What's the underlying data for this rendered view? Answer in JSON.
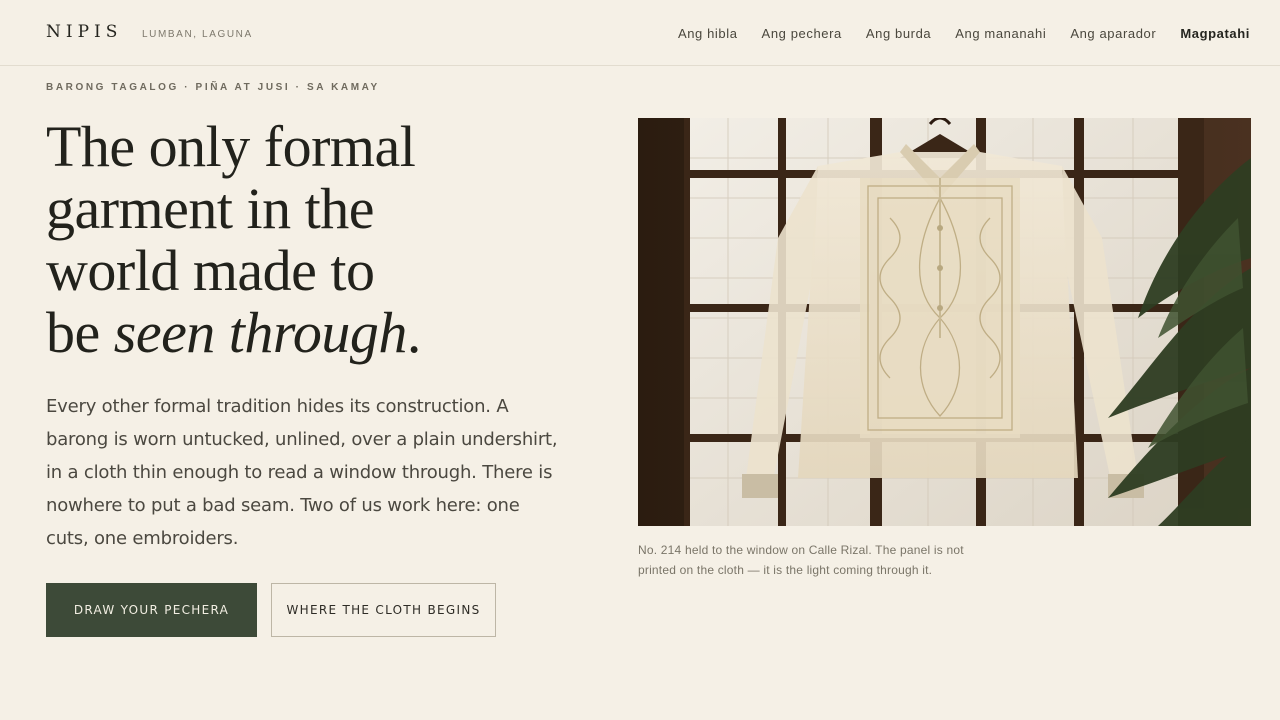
{
  "brand": {
    "name": "NIPIS",
    "location": "LUMBAN, LAGUNA"
  },
  "nav": {
    "items": [
      "Ang hibla",
      "Ang pechera",
      "Ang burda",
      "Ang mananahi",
      "Ang aparador"
    ],
    "cta": "Magpatahi"
  },
  "hero": {
    "eyebrow": "BARONG TAGALOG · PIÑA AT JUSI · SA KAMAY",
    "headline_lines": [
      "The only formal",
      "garment in the",
      "world made to",
      "be "
    ],
    "headline_emph": "seen through",
    "headline_end": ".",
    "lede": "Every other formal tradition hides its construction. A barong is worn untucked, unlined, over a plain undershirt, in a cloth thin enough to read a window through. There is nowhere to put a bad seam. Two of us work here: one cuts, one embroiders.",
    "primary_button": "DRAW YOUR PECHERA",
    "secondary_button": "WHERE THE CLOTH BEGINS"
  },
  "photo": {
    "caption": "No. 214 held to the window on Calle Rizal. The panel is not printed on the cloth — it is the light coming through it."
  },
  "colors": {
    "background": "#f5f0e6",
    "primary_button": "#3d4a38",
    "text": "#22221c"
  }
}
